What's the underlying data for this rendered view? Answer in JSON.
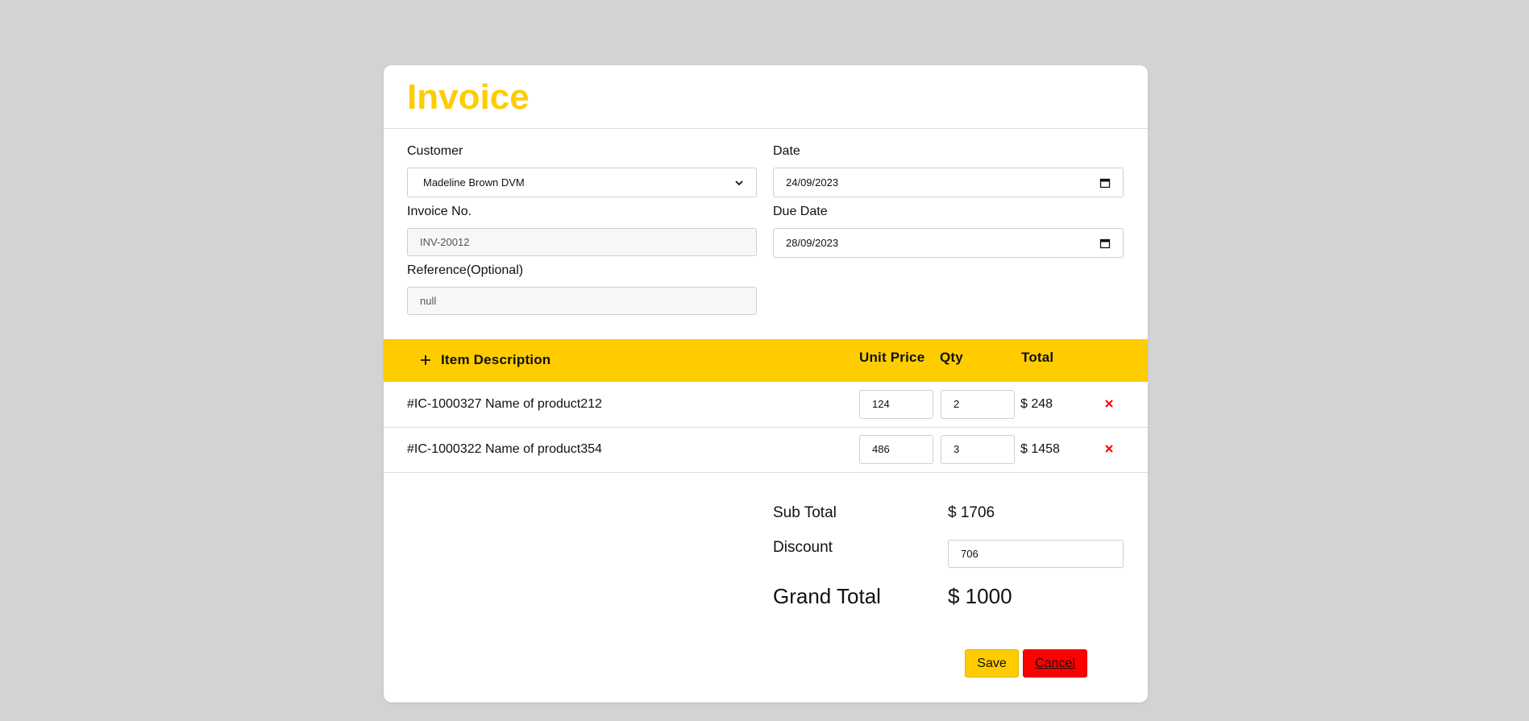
{
  "invoice": {
    "title": "Invoice"
  },
  "form": {
    "customer_label": "Customer",
    "customer_value": "Madeline Brown DVM",
    "date_label": "Date",
    "date_value": "24/09/2023",
    "invoice_no_label": "Invoice No.",
    "invoice_no_value": "INV-20012",
    "due_date_label": "Due Date",
    "due_date_value": "28/09/2023",
    "reference_label": "Reference(Optional)",
    "reference_value": "null"
  },
  "table": {
    "headers": {
      "add_icon": "plus-icon",
      "description": "Item Description",
      "unit_price": "Unit Price",
      "qty": "Qty",
      "total": "Total"
    },
    "rows": [
      {
        "description": "#IC-1000327 Name of product212",
        "unit_price": "124",
        "qty": "2",
        "total": "$ 248",
        "remove_icon": "close-icon"
      },
      {
        "description": "#IC-1000322 Name of product354",
        "unit_price": "486",
        "qty": "3",
        "total": "$ 1458",
        "remove_icon": "close-icon"
      }
    ]
  },
  "summary": {
    "subtotal_label": "Sub Total",
    "subtotal_value": "$ 1706",
    "discount_label": "Discount",
    "discount_value": "706",
    "grand_total_label": "Grand Total",
    "grand_total_value": "$ 1000"
  },
  "actions": {
    "save_label": "Save",
    "cancel_label": "Cancel"
  },
  "colors": {
    "accent": "#ffcc00",
    "danger": "#ff0000",
    "background": "#d3d3d3"
  }
}
